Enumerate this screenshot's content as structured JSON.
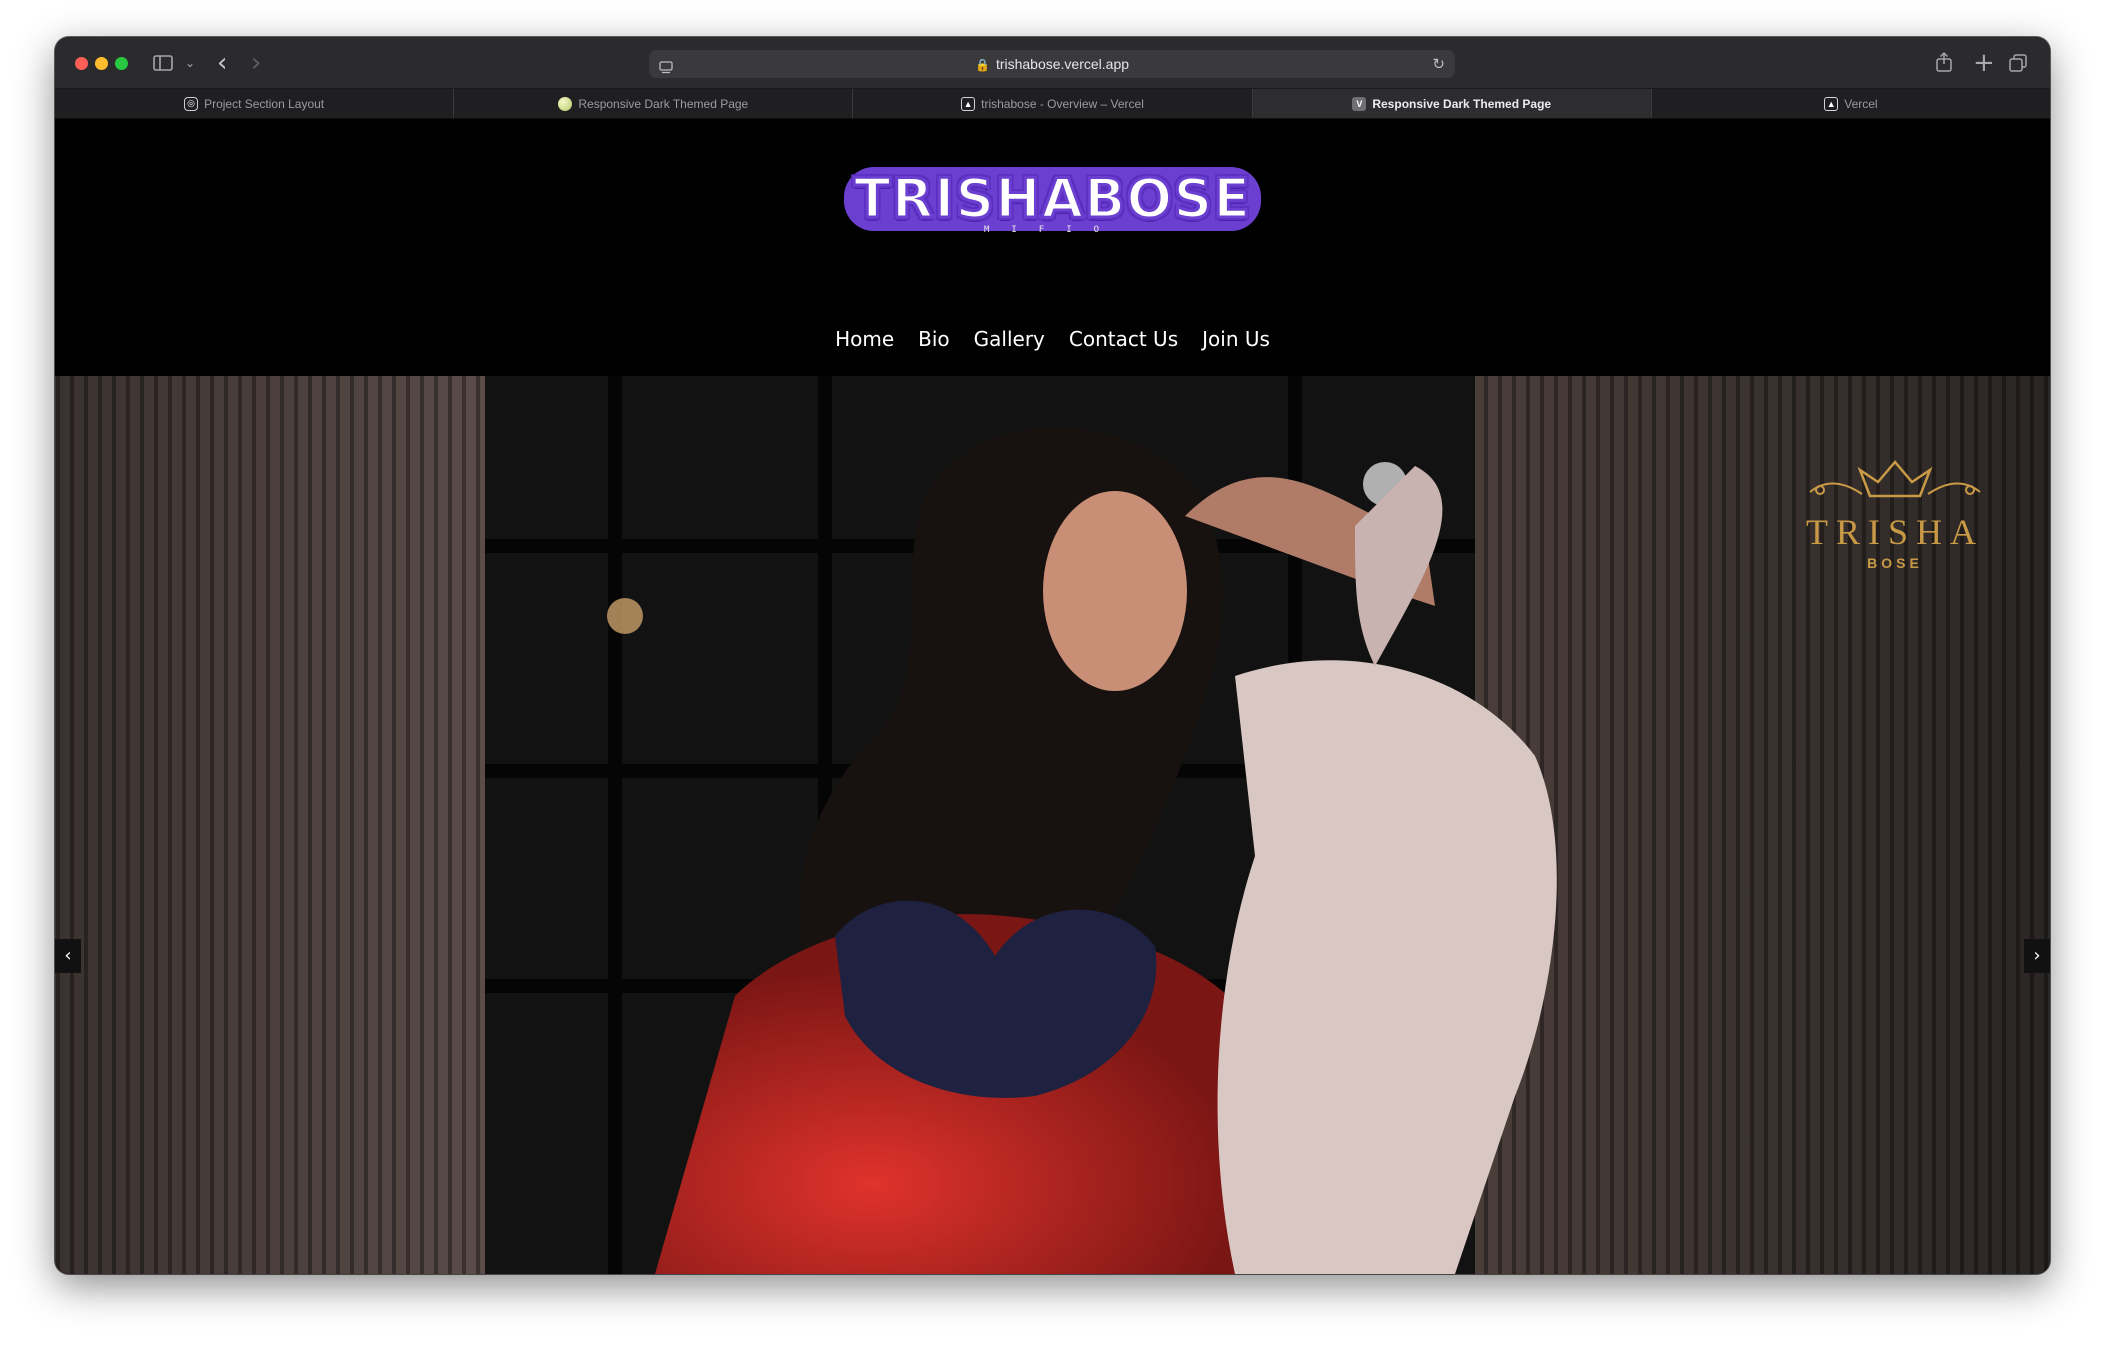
{
  "browser": {
    "url": "trishabose.vercel.app",
    "tabs": [
      {
        "label": "Project Section Layout",
        "icon": "openai-icon",
        "active": false
      },
      {
        "label": "Responsive Dark Themed Page",
        "icon": "ball-icon",
        "active": false
      },
      {
        "label": "trishabose - Overview – Vercel",
        "icon": "vercel-icon",
        "active": false
      },
      {
        "label": "Responsive Dark Themed Page",
        "icon": "v-icon",
        "active": true
      },
      {
        "label": "Vercel",
        "icon": "vercel-icon",
        "active": false
      }
    ]
  },
  "site": {
    "logo_text": "TRISHABOSE",
    "logo_subtext": "MIFIO",
    "nav": [
      "Home",
      "Bio",
      "Gallery",
      "Contact Us",
      "Join Us"
    ]
  },
  "hero": {
    "brand_name": "TRISHA",
    "brand_sub": "BOSE",
    "prev_glyph": "‹",
    "next_glyph": "›"
  },
  "colors": {
    "logo_purple": "#6b3fd0",
    "gold": "#c99a46",
    "page_bg": "#000000"
  }
}
